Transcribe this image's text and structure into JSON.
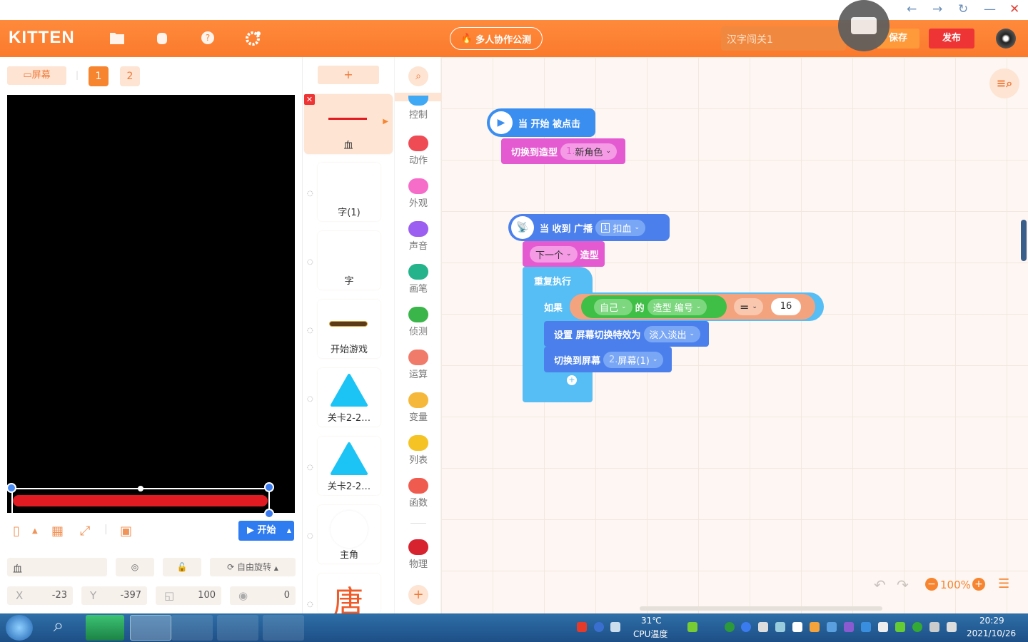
{
  "app": {
    "logo": "KITTEN",
    "collab_label": "多人协作公测",
    "project_name": "汉字闯关1",
    "save_label": "保存",
    "publish_label": "发布"
  },
  "window_controls": {
    "back": "←",
    "forward": "→",
    "refresh": "↻",
    "minimize": "—",
    "close": "✕"
  },
  "stage": {
    "screen_label": "屏幕",
    "tabs": [
      "1",
      "2"
    ],
    "start_label": "开始"
  },
  "props": {
    "name": "血",
    "rotation_mode": "自由旋转",
    "x_label": "X",
    "x": "-23",
    "y_label": "Y",
    "y": "-397",
    "size": "100",
    "angle": "0"
  },
  "sprites": [
    "血",
    "字(1)",
    "字",
    "开始游戏",
    "关卡2-2…",
    "关卡2-2…",
    "主角",
    "唐"
  ],
  "add_label": "+",
  "categories": [
    {
      "label": "控制",
      "color": "#3fa9f5"
    },
    {
      "label": "动作",
      "color": "#ee4b55"
    },
    {
      "label": "外观",
      "color": "#f56dc9"
    },
    {
      "label": "声音",
      "color": "#9b5ef0"
    },
    {
      "label": "画笔",
      "color": "#25b38b"
    },
    {
      "label": "侦测",
      "color": "#3ab54a"
    },
    {
      "label": "运算",
      "color": "#f07b6a"
    },
    {
      "label": "变量",
      "color": "#f5b83a"
    },
    {
      "label": "列表",
      "color": "#f5c324"
    },
    {
      "label": "函数",
      "color": "#ef5c4f"
    },
    {
      "label": "物理",
      "color": "#d6232f"
    }
  ],
  "blocks": {
    "when_start": "当 开始 被点击",
    "switch_costume": "切换到造型",
    "costume_num": "1.",
    "costume_val": "新角色",
    "when_receive": "当 收到 广播",
    "broadcast_num": "1",
    "broadcast_val": "扣血",
    "next_val": "下一个",
    "next_label": "造型",
    "repeat": "重复执行",
    "if": "如果",
    "self": "自己",
    "of": "的",
    "costume_id": "造型 编号",
    "eq": "=",
    "num16": "16",
    "set_effect": "设置 屏幕切换特效为",
    "effect_val": "淡入淡出",
    "switch_screen": "切换到屏幕",
    "screen_num": "2.",
    "screen_val": "屏幕(1)",
    "plus": "+"
  },
  "zoom": "100%",
  "taskbar": {
    "temp": "31℃",
    "cpu_label": "CPU温度",
    "time": "20:29",
    "date": "2021/10/26"
  }
}
